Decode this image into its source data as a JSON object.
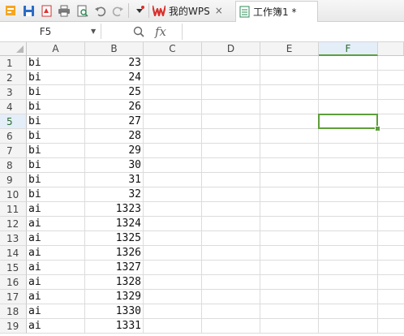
{
  "toolbar": {
    "icons": [
      "app-logo-icon",
      "save-icon",
      "pdf-icon",
      "print-icon",
      "print-preview-icon",
      "undo-icon",
      "redo-icon",
      "more-icon"
    ],
    "tabs": [
      {
        "label": "我的WPS",
        "icon": "wps-logo-icon",
        "active": false,
        "close": "×"
      },
      {
        "label": "工作簿1 *",
        "icon": "workbook-icon",
        "active": true,
        "close": ""
      }
    ]
  },
  "formula_bar": {
    "name_box": "F5",
    "zoom_glyph": "ℚ",
    "fx_label": "fx",
    "formula_value": ""
  },
  "sheet": {
    "columns": [
      "A",
      "B",
      "C",
      "D",
      "E",
      "F"
    ],
    "selected_column": "F",
    "selected_row": 5,
    "active_cell": "F5",
    "rows": [
      {
        "num": "1",
        "a": "bi",
        "b": "23"
      },
      {
        "num": "2",
        "a": "bi",
        "b": "24"
      },
      {
        "num": "3",
        "a": "bi",
        "b": "25"
      },
      {
        "num": "4",
        "a": "bi",
        "b": "26"
      },
      {
        "num": "5",
        "a": "bi",
        "b": "27"
      },
      {
        "num": "6",
        "a": "bi",
        "b": "28"
      },
      {
        "num": "7",
        "a": "bi",
        "b": "29"
      },
      {
        "num": "8",
        "a": "bi",
        "b": "30"
      },
      {
        "num": "9",
        "a": "bi",
        "b": "31"
      },
      {
        "num": "10",
        "a": "bi",
        "b": "32"
      },
      {
        "num": "11",
        "a": "ai",
        "b": "1323"
      },
      {
        "num": "12",
        "a": "ai",
        "b": "1324"
      },
      {
        "num": "13",
        "a": "ai",
        "b": "1325"
      },
      {
        "num": "14",
        "a": "ai",
        "b": "1326"
      },
      {
        "num": "15",
        "a": "ai",
        "b": "1327"
      },
      {
        "num": "16",
        "a": "ai",
        "b": "1328"
      },
      {
        "num": "17",
        "a": "ai",
        "b": "1329"
      },
      {
        "num": "18",
        "a": "ai",
        "b": "1330"
      },
      {
        "num": "19",
        "a": "ai",
        "b": "1331"
      }
    ]
  },
  "colors": {
    "accent": "#5e9e3b",
    "header_bg": "#f4f4f4",
    "wps_red": "#d9302c"
  }
}
